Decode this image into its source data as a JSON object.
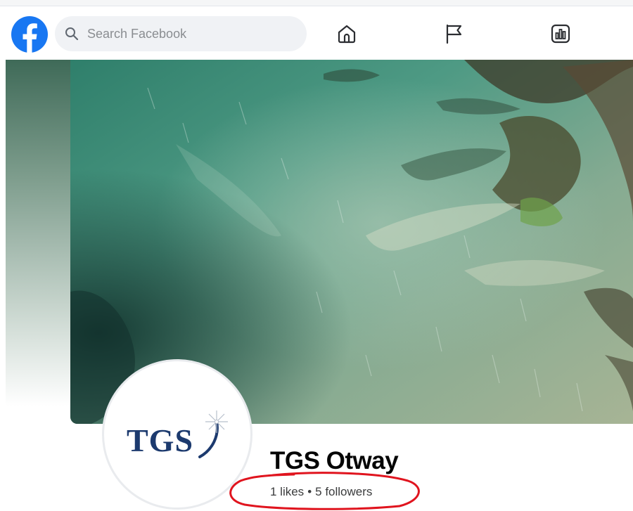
{
  "navbar": {
    "search": {
      "placeholder": "Search Facebook"
    },
    "icons": [
      "facebook-logo-icon",
      "search-icon",
      "home-icon",
      "flag-icon",
      "insights-icon"
    ]
  },
  "colors": {
    "brand": "#1877f2",
    "annotation": "#e0141e",
    "logo_text": "#1c3a6e",
    "search_bg": "#f0f2f5"
  },
  "profile": {
    "avatar_logo_text": "TGS",
    "name": "TGS Otway",
    "likes": "1 likes",
    "separator": "•",
    "followers": "5 followers"
  }
}
